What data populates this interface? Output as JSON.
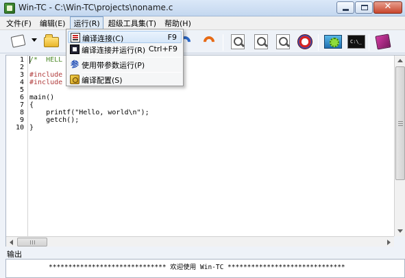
{
  "window": {
    "title": "Win-TC - C:\\Win-TC\\projects\\noname.c",
    "close_glyph": "✕"
  },
  "menubar": {
    "items": [
      "文件(F)",
      "编辑(E)",
      "运行(R)",
      "超级工具集(T)",
      "帮助(H)"
    ],
    "active_index": 2
  },
  "run_menu": {
    "items": [
      {
        "label": "编译连接(C)",
        "shortcut": "F9",
        "icon": "compile-icon"
      },
      {
        "label": "编译连接并运行(R)",
        "shortcut": "Ctrl+F9",
        "icon": "compile-run-icon"
      },
      {
        "label": "使用带参数运行(P)",
        "shortcut": "",
        "icon": "params-icon",
        "glyph": "参"
      },
      {
        "label": "编译配置(S)",
        "shortcut": "",
        "icon": "config-icon"
      }
    ]
  },
  "toolbar": {
    "console_text": "C:\\_"
  },
  "editor": {
    "lines": [
      {
        "num": "1",
        "text": "/*  HELL"
      },
      {
        "num": "2",
        "text": ""
      },
      {
        "num": "3",
        "text": "#include"
      },
      {
        "num": "4",
        "text": "#include"
      },
      {
        "num": "5",
        "text": ""
      },
      {
        "num": "6",
        "text": "main()"
      },
      {
        "num": "7",
        "text": "{"
      },
      {
        "num": "8",
        "text": "    printf(\"Hello, world\\n\");"
      },
      {
        "num": "9",
        "text": "    getch();"
      },
      {
        "num": "10",
        "text": "}"
      }
    ]
  },
  "output": {
    "label": "输出",
    "line": "****************************** 欢迎使用 Win-TC ******************************"
  }
}
